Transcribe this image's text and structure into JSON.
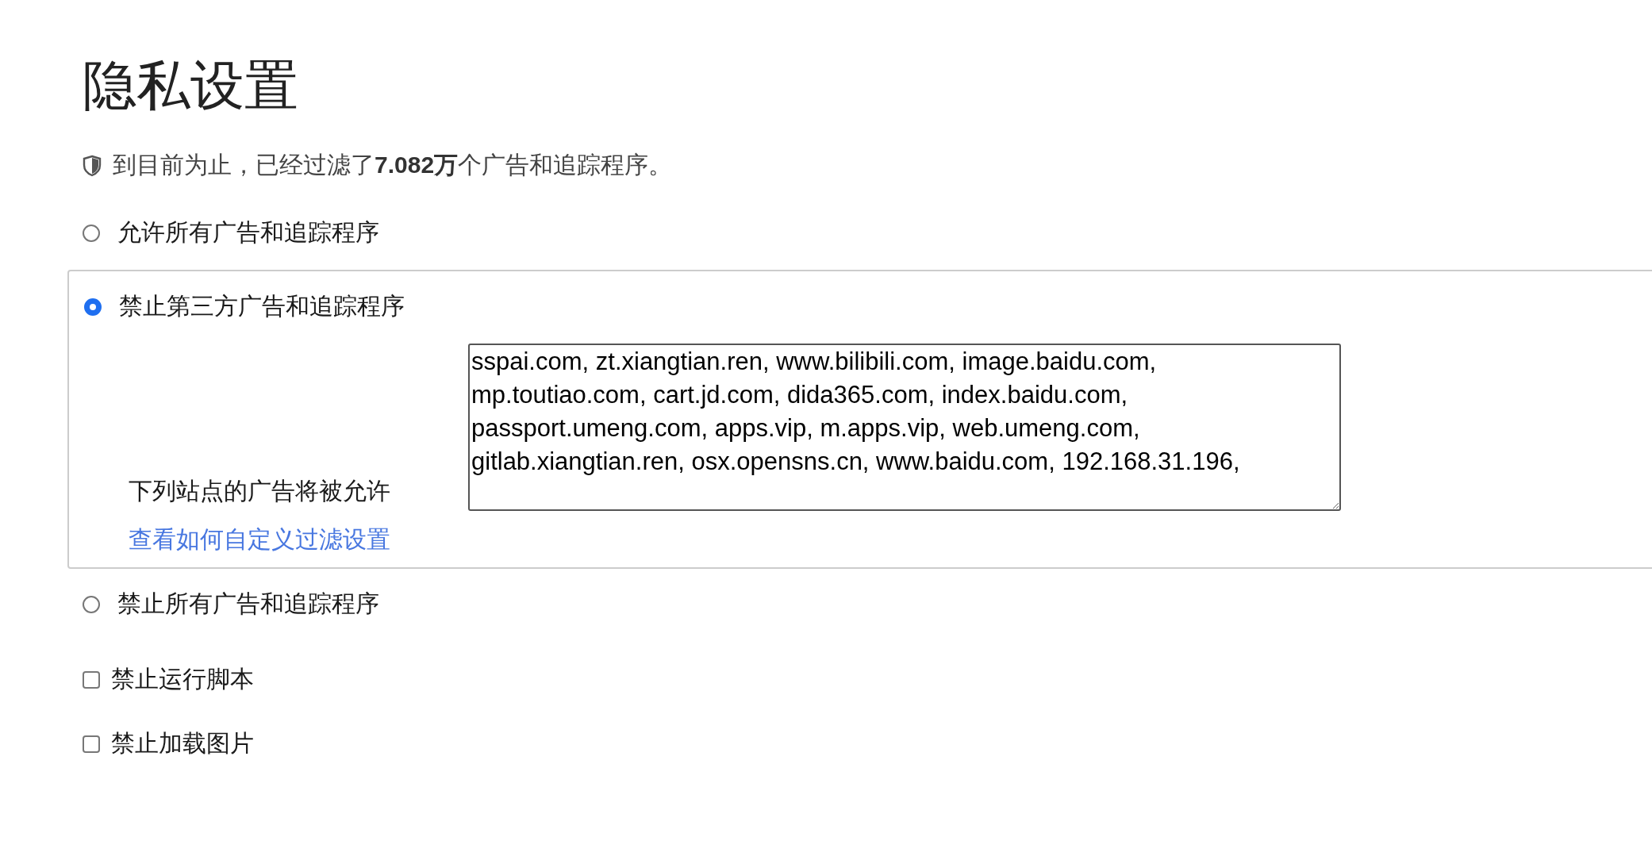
{
  "page": {
    "title": "隐私设置"
  },
  "stats": {
    "text": "到目前为止，已经过滤了**7.082万**个广告和追踪程序。"
  },
  "filter_options": [
    {
      "label": "允许所有广告和追踪程序",
      "selected": false
    },
    {
      "label": "禁止第三方广告和追踪程序",
      "selected": true,
      "allowlist": {
        "label": "下列站点的广告将被允许",
        "value": "sspai.com, zt.xiangtian.ren, www.bilibili.com, image.baidu.com, mp.toutiao.com, cart.jd.com, dida365.com, index.baidu.com, passport.umeng.com, apps.vip, m.apps.vip, web.umeng.com, gitlab.xiangtian.ren, osx.opensns.cn, www.baidu.com, 192.168.31.196,",
        "link": "查看如何自定义过滤设置"
      }
    },
    {
      "label": "禁止所有广告和追踪程序",
      "selected": false
    }
  ],
  "checkboxes": [
    {
      "label": "禁止运行脚本",
      "checked": false
    },
    {
      "label": "禁止加载图片",
      "checked": false
    }
  ]
}
